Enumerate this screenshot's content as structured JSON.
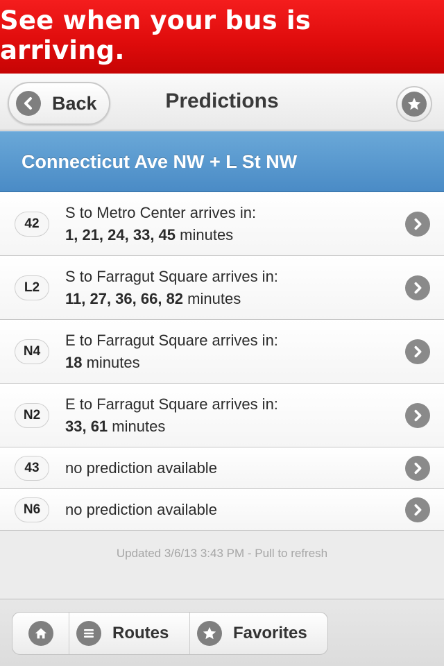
{
  "banner": {
    "text": "See when your bus is arriving."
  },
  "navbar": {
    "back_label": "Back",
    "title": "Predictions"
  },
  "stop": {
    "name": "Connecticut Ave NW + L St NW"
  },
  "predictions": [
    {
      "route": "42",
      "direction": "S to Metro Center arrives in:",
      "times": "1, 21, 24, 33, 45",
      "unit": " minutes"
    },
    {
      "route": "L2",
      "direction": "S to Farragut Square arrives in:",
      "times": "11, 27, 36, 66, 82",
      "unit": " minutes"
    },
    {
      "route": "N4",
      "direction": "E to Farragut Square arrives in:",
      "times": "18",
      "unit": " minutes"
    },
    {
      "route": "N2",
      "direction": "E to Farragut Square arrives in:",
      "times": "33, 61",
      "unit": " minutes"
    },
    {
      "route": "43",
      "message": "no prediction available"
    },
    {
      "route": "N6",
      "message": "no prediction available"
    }
  ],
  "status": {
    "updated": "Updated 3/6/13 3:43 PM - Pull to refresh"
  },
  "footer": {
    "routes_label": "Routes",
    "favorites_label": "Favorites"
  },
  "icons": {
    "back": "chevron-left-icon",
    "favorite": "star-icon",
    "row_action": "chevron-right-icon",
    "home": "home-icon",
    "routes": "list-icon"
  },
  "colors": {
    "banner": "#e01010",
    "header": "#5699cf",
    "icon_gray": "#808080"
  }
}
